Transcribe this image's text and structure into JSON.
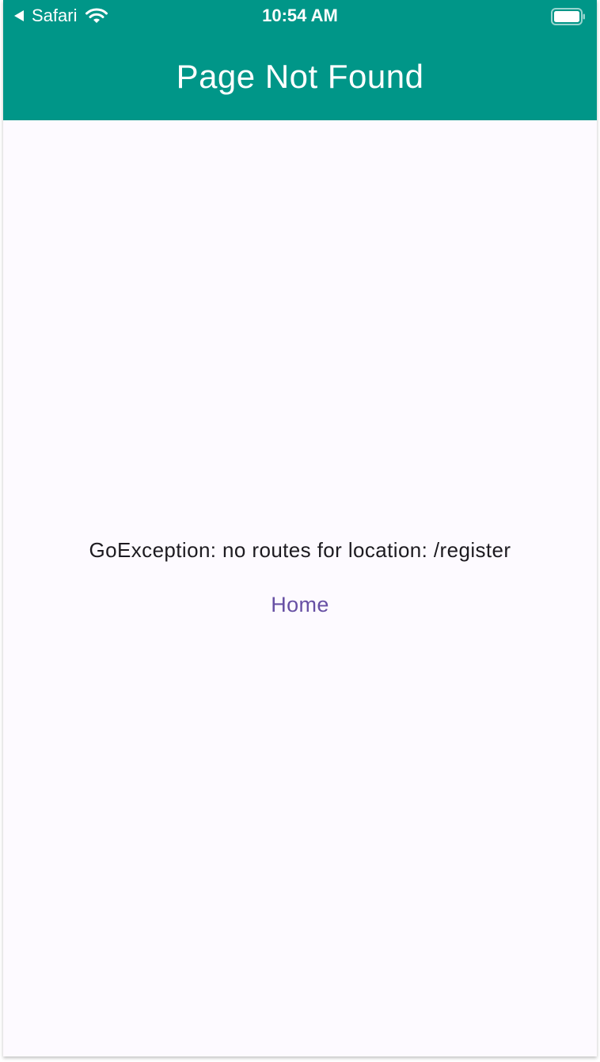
{
  "status_bar": {
    "back_app": "Safari",
    "time": "10:54 AM",
    "icons": [
      "back-arrow-icon",
      "wifi-icon",
      "battery-icon"
    ]
  },
  "app_bar": {
    "title": "Page Not Found"
  },
  "content": {
    "error_message": "GoException: no routes for location: /register",
    "home_button_label": "Home"
  },
  "colors": {
    "app_bar": "#009688",
    "background": "#fdfaff",
    "text": "#1d1b20",
    "link": "#6750a4"
  }
}
